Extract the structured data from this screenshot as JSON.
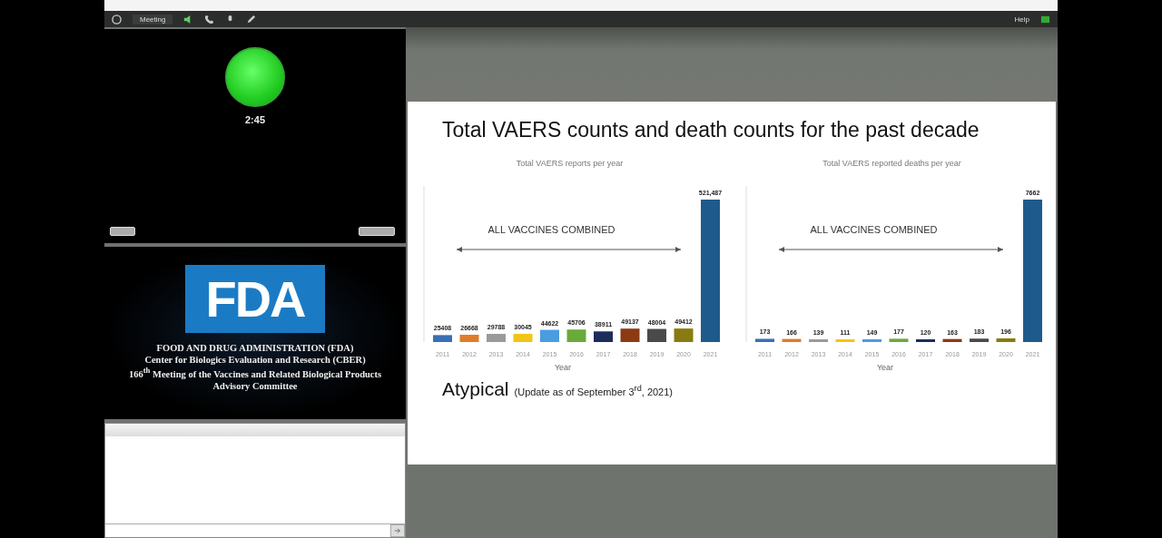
{
  "toolbar": {
    "menu": "Meeting",
    "help": "Help"
  },
  "timer_pod": {
    "time": "2:45"
  },
  "fda_pod": {
    "logo": "FDA",
    "lines": [
      "FOOD AND DRUG ADMINISTRATION (FDA)",
      "Center for Biologics Evaluation and Research (CBER)",
      "166$^{th}$ Meeting of the Vaccines and Related Biological Products Advisory Committee"
    ]
  },
  "slide": {
    "title": "Total VAERS counts and death counts for the past decade",
    "charts": [
      {
        "chart_data": {
          "type": "bar",
          "title": "Total VAERS reports per year",
          "xlabel": "Year",
          "categories": [
            "2011",
            "2012",
            "2013",
            "2014",
            "2015",
            "2016",
            "2017",
            "2018",
            "2019",
            "2020",
            "2021"
          ],
          "values": [
            25408,
            26668,
            29788,
            30045,
            44622,
            45706,
            38911,
            49137,
            48004,
            49412,
            521487
          ],
          "value_labels": [
            "25408",
            "26668",
            "29788",
            "30045",
            "44622",
            "45706",
            "38911",
            "49137",
            "48004",
            "49412",
            "521,487"
          ],
          "colors": [
            "#3a6fb5",
            "#e07b2a",
            "#9a9a9a",
            "#f2c418",
            "#4a9de0",
            "#6aaa3a",
            "#1b2d5a",
            "#8b3a14",
            "#4a4a4a",
            "#8a7a12",
            "#1f5a8c"
          ],
          "annotations": [
            {
              "text": "ALL VACCINES COMBINED"
            }
          ]
        }
      },
      {
        "chart_data": {
          "type": "bar",
          "title": "Total VAERS reported deaths per year",
          "xlabel": "Year",
          "categories": [
            "2011",
            "2012",
            "2013",
            "2014",
            "2015",
            "2016",
            "2017",
            "2018",
            "2019",
            "2020",
            "2021"
          ],
          "values": [
            173,
            166,
            139,
            111,
            149,
            177,
            120,
            163,
            183,
            196,
            7662
          ],
          "value_labels": [
            "173",
            "166",
            "139",
            "111",
            "149",
            "177",
            "120",
            "163",
            "183",
            "196",
            "7662"
          ],
          "colors": [
            "#3a6fb5",
            "#e07b2a",
            "#9a9a9a",
            "#f2c418",
            "#4a9de0",
            "#6aaa3a",
            "#1b2d5a",
            "#8b3a14",
            "#4a4a4a",
            "#8a7a12",
            "#1f5a8c"
          ],
          "annotations": [
            {
              "text": "ALL VACCINES COMBINED"
            }
          ]
        }
      }
    ],
    "heading": "Atypical",
    "note": "(Update as of September 3$^{rd}$, 2021)"
  }
}
